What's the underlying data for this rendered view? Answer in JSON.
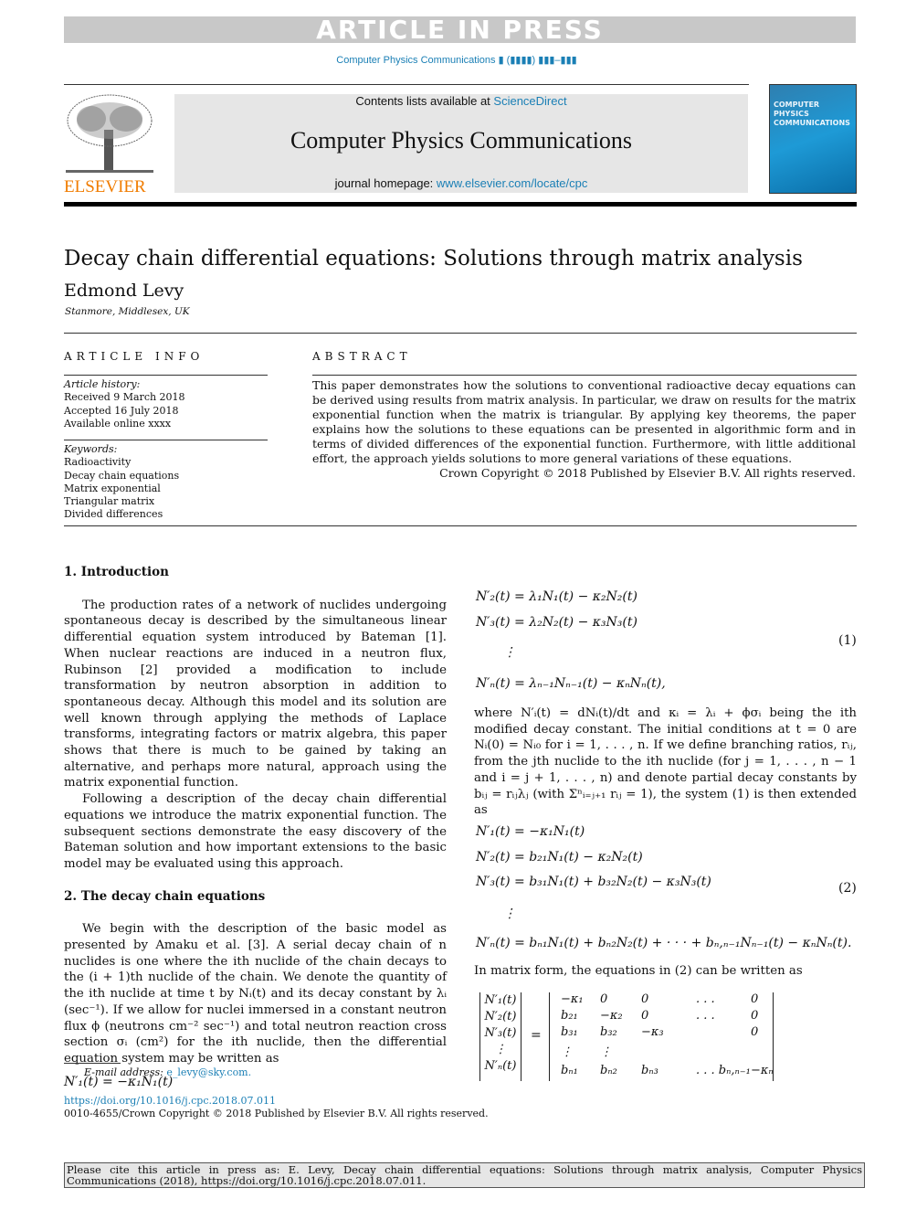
{
  "banner": {
    "article_in_press": "ARTICLE IN PRESS",
    "journal_ref": "Computer Physics Communications ▮ (▮▮▮▮) ▮▮▮–▮▮▮"
  },
  "masthead": {
    "contents_prefix": "Contents lists available at ",
    "sciencedirect": "ScienceDirect",
    "journal_title": "Computer Physics Communications",
    "homepage_prefix": "journal homepage: ",
    "homepage_url": "www.elsevier.com/locate/cpc",
    "publisher_logo": "ELSEVIER",
    "cover_text": "COMPUTER PHYSICS COMMUNICATIONS"
  },
  "article": {
    "title": "Decay chain differential equations: Solutions through matrix analysis",
    "author": "Edmond Levy",
    "affiliation": "Stanmore, Middlesex, UK"
  },
  "article_info": {
    "heading": "ARTICLE INFO",
    "history_label": "Article history:",
    "history": [
      "Received 9 March 2018",
      "Accepted 16 July 2018",
      "Available online xxxx"
    ],
    "keywords_label": "Keywords:",
    "keywords": [
      "Radioactivity",
      "Decay chain equations",
      "Matrix exponential",
      "Triangular matrix",
      "Divided differences"
    ]
  },
  "abstract": {
    "heading": "ABSTRACT",
    "text": "This paper demonstrates how the solutions to conventional radioactive decay equations can be derived using results from matrix analysis. In particular, we draw on results for the matrix exponential function when the matrix is triangular. By applying key theorems, the paper explains how the solutions to these equations can be presented in algorithmic form and in terms of divided differences of the exponential function. Furthermore, with little additional effort, the approach yields solutions to more general variations of these equations.",
    "copyright": "Crown Copyright © 2018 Published by Elsevier B.V. All rights reserved."
  },
  "sections": [
    {
      "heading": "1.  Introduction",
      "paragraphs": [
        "The production rates of a network of nuclides undergoing spontaneous decay is described by the simultaneous linear differential equation system introduced by Bateman [1]. When nuclear reactions are induced in a neutron flux, Rubinson [2] provided a modification to include transformation by neutron absorption in addition to spontaneous decay. Although this model and its solution are well known through applying the methods of Laplace transforms, integrating factors or matrix algebra, this paper shows that there is much to be gained by taking an alternative, and perhaps more natural, approach using the matrix exponential function.",
        "Following a description of the decay chain differential equations we introduce the matrix exponential function. The subsequent sections demonstrate the easy discovery of the Bateman solution and how important extensions to the basic model may be evaluated using this approach."
      ]
    },
    {
      "heading": "2.  The decay chain equations",
      "paragraphs": [
        "We begin with the description of the basic model as presented by Amaku et al. [3]. A serial decay chain of n nuclides is one where the ith nuclide of the chain decays to the (i + 1)th nuclide of the chain. We denote the quantity of the ith nuclide at time t by Nᵢ(t) and its decay constant by λᵢ (sec⁻¹). If we allow for nuclei immersed in a constant neutron flux ϕ (neutrons cm⁻² sec⁻¹) and total neutron reaction cross section σᵢ (cm²) for the ith nuclide, then the differential equation system may be written as"
      ]
    }
  ],
  "equations": {
    "left_eq": "N′₁(t) = −κ₁N₁(t)",
    "eq1": [
      "N′₂(t) = λ₁N₁(t) − κ₂N₂(t)",
      "N′₃(t) = λ₂N₂(t) − κ₃N₃(t)",
      "⋮",
      "N′ₙ(t) = λₙ₋₁Nₙ₋₁(t) − κₙNₙ(t),"
    ],
    "eq1_number": "(1)",
    "text_after_1": "where N′ᵢ(t) = dNᵢ(t)/dt and κᵢ = λᵢ + ϕσᵢ being the ith modified decay constant. The initial conditions at t = 0 are Nᵢ(0) = Nᵢ₀ for i = 1, . . . , n. If we define branching ratios, rᵢⱼ, from the jth nuclide to the ith nuclide (for j = 1, . . . , n − 1 and i = j + 1, . . . , n) and denote partial decay constants by bᵢⱼ = rᵢⱼλⱼ (with Σⁿᵢ₌ⱼ₊₁ rᵢⱼ = 1), the system (1) is then extended as",
    "eq2": [
      "N′₁(t) = −κ₁N₁(t)",
      "N′₂(t) = b₂₁N₁(t) − κ₂N₂(t)",
      "N′₃(t) = b₃₁N₁(t) + b₃₂N₂(t) − κ₃N₃(t)",
      "⋮",
      "N′ₙ(t) = bₙ₁N₁(t) + bₙ₂N₂(t) + · · · + bₙ,ₙ₋₁Nₙ₋₁(t) − κₙNₙ(t)."
    ],
    "eq2_number": "(2)",
    "text_after_2": "In matrix form, the equations in (2) can be written as",
    "matrix_lhs": [
      "N′₁(t)",
      "N′₂(t)",
      "N′₃(t)",
      "⋮",
      "N′ₙ(t)"
    ],
    "matrix_rhs": [
      [
        "−κ₁",
        "0",
        "0",
        ". . .",
        "0"
      ],
      [
        "b₂₁",
        "−κ₂",
        "0",
        ". . .",
        "0"
      ],
      [
        "b₃₁",
        "b₃₂",
        "−κ₃",
        "",
        "0"
      ],
      [
        "⋮",
        "⋮",
        "",
        "",
        ""
      ],
      [
        "bₙ₁",
        "bₙ₂",
        "bₙ₃",
        ". . . bₙ,ₙ₋₁",
        "−κₙ"
      ]
    ]
  },
  "footnote": {
    "email_label": "E-mail address: ",
    "email": "e_levy@sky.com."
  },
  "doi": {
    "link": "https://doi.org/10.1016/j.cpc.2018.07.011",
    "rights": "0010-4655/Crown Copyright © 2018 Published by Elsevier B.V. All rights reserved."
  },
  "citation": "Please cite this article in press as: E. Levy, Decay chain differential equations: Solutions through matrix analysis, Computer Physics Communications (2018), https://doi.org/10.1016/j.cpc.2018.07.011.",
  "colors": {
    "link": "#1a7fb5",
    "elsevier_orange": "#f07c00",
    "banner_gray": "#c8c8c8"
  }
}
